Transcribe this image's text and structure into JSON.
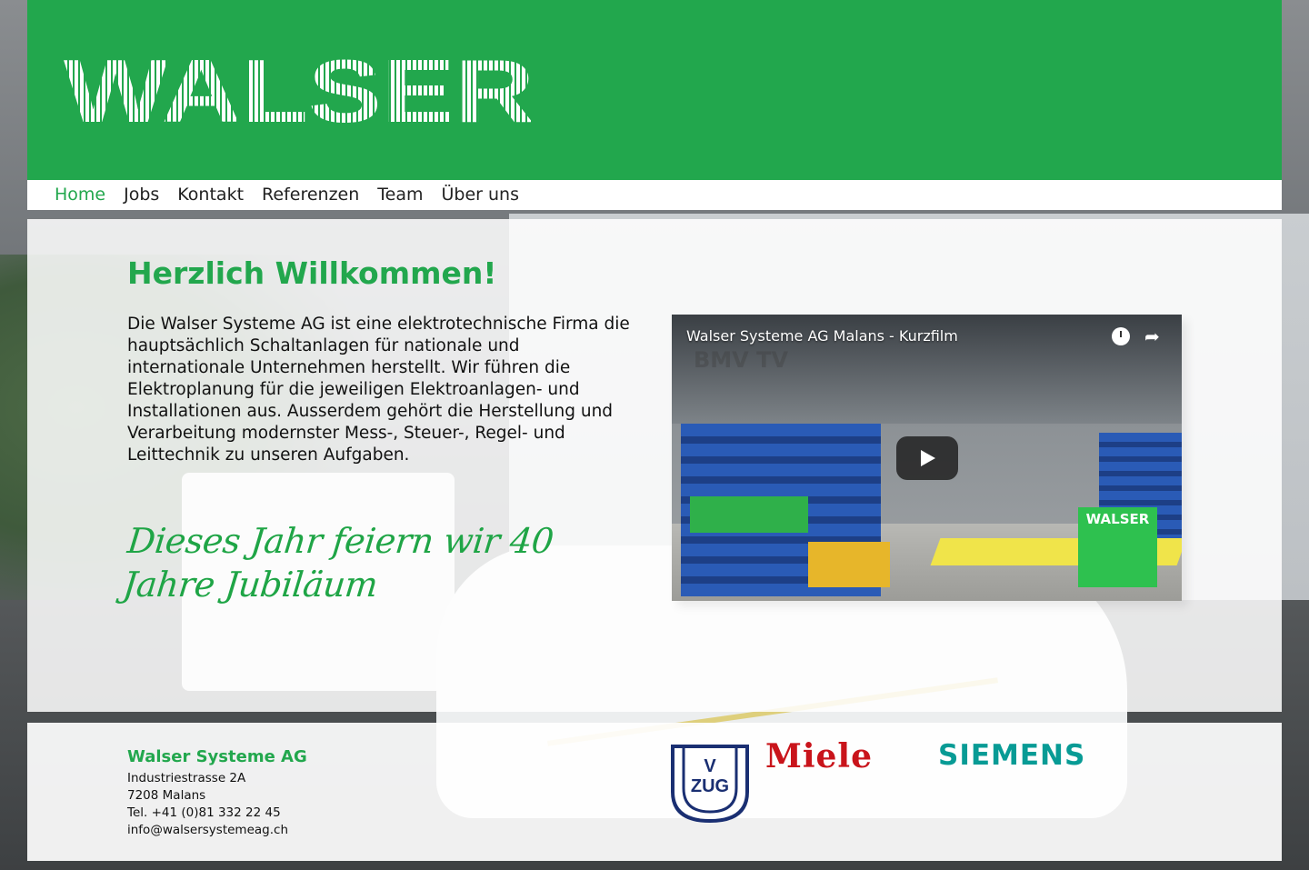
{
  "brand": {
    "logo_text": "WALSER",
    "brand_green": "#22a74d"
  },
  "nav": {
    "items": [
      {
        "label": "Home",
        "active": true
      },
      {
        "label": "Jobs",
        "active": false
      },
      {
        "label": "Kontakt",
        "active": false
      },
      {
        "label": "Referenzen",
        "active": false
      },
      {
        "label": "Team",
        "active": false
      },
      {
        "label": "Über uns",
        "active": false
      }
    ]
  },
  "main": {
    "heading": "Herzlich Willkommen!",
    "intro": "Die Walser Systeme AG ist eine elektrotechnische Firma die hauptsächlich Schaltanlagen für nationale und internationale Unternehmen herstellt. Wir führen die Elektroplanung für die jeweiligen Elektroanlagen- und Installationen aus. Ausserdem gehört die Herstellung und Verarbeitung modernster Mess-, Steuer-, Regel- und Leittechnik zu unseren Aufgaben.",
    "jubilee": "Dieses Jahr feiern wir 40 Jahre Jubiläum"
  },
  "video": {
    "title": "Walser Systeme AG Malans - Kurzfilm",
    "watermark": "BMV TV",
    "badge": "WALSER",
    "icons": [
      "clock-icon",
      "share-icon",
      "play-icon"
    ]
  },
  "footer": {
    "company": "Walser Systeme AG",
    "street": "Industriestrasse 2A",
    "city": "7208 Malans",
    "phone": "Tel. +41 (0)81 332 22 45",
    "email": "info@walsersystemeag.ch",
    "partners": {
      "vzug": "V ZUG",
      "miele": "Miele",
      "siemens": "SIEMENS"
    }
  }
}
